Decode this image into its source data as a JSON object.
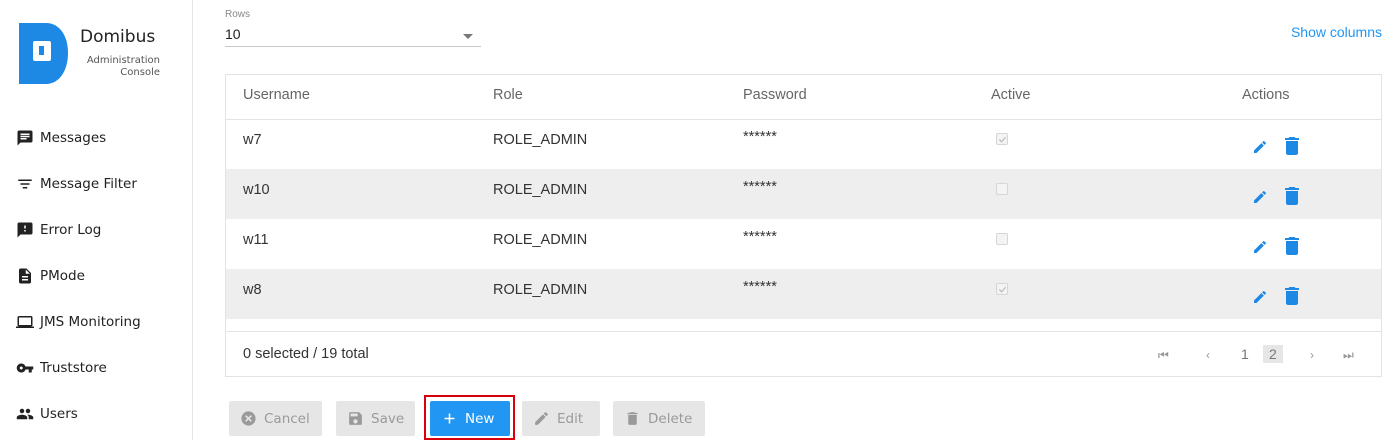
{
  "brand": {
    "title": "Domibus",
    "subtitle": "Administration Console"
  },
  "sidebar": {
    "items": [
      {
        "label": "Messages",
        "icon": "message-icon"
      },
      {
        "label": "Message Filter",
        "icon": "filter-icon"
      },
      {
        "label": "Error Log",
        "icon": "error-icon"
      },
      {
        "label": "PMode",
        "icon": "document-icon"
      },
      {
        "label": "JMS Monitoring",
        "icon": "laptop-icon"
      },
      {
        "label": "Truststore",
        "icon": "key-icon"
      },
      {
        "label": "Users",
        "icon": "users-icon"
      }
    ]
  },
  "rows": {
    "label": "Rows",
    "value": "10"
  },
  "show_columns": "Show columns",
  "table": {
    "columns": [
      "Username",
      "Role",
      "Password",
      "Active",
      "Actions"
    ],
    "rows": [
      {
        "username": "w7",
        "role": "ROLE_ADMIN",
        "password": "******",
        "active": true
      },
      {
        "username": "w10",
        "role": "ROLE_ADMIN",
        "password": "******",
        "active": false
      },
      {
        "username": "w11",
        "role": "ROLE_ADMIN",
        "password": "******",
        "active": false
      },
      {
        "username": "w8",
        "role": "ROLE_ADMIN",
        "password": "******",
        "active": true
      }
    ],
    "footer": "0 selected / 19 total",
    "pages": [
      "1",
      "2"
    ],
    "current_page": "2"
  },
  "buttons": {
    "cancel": "Cancel",
    "save": "Save",
    "new": "New",
    "edit": "Edit",
    "delete": "Delete"
  },
  "colors": {
    "accent": "#2196f3",
    "highlight": "#d9000d",
    "alt_row": "#eeeeee"
  }
}
